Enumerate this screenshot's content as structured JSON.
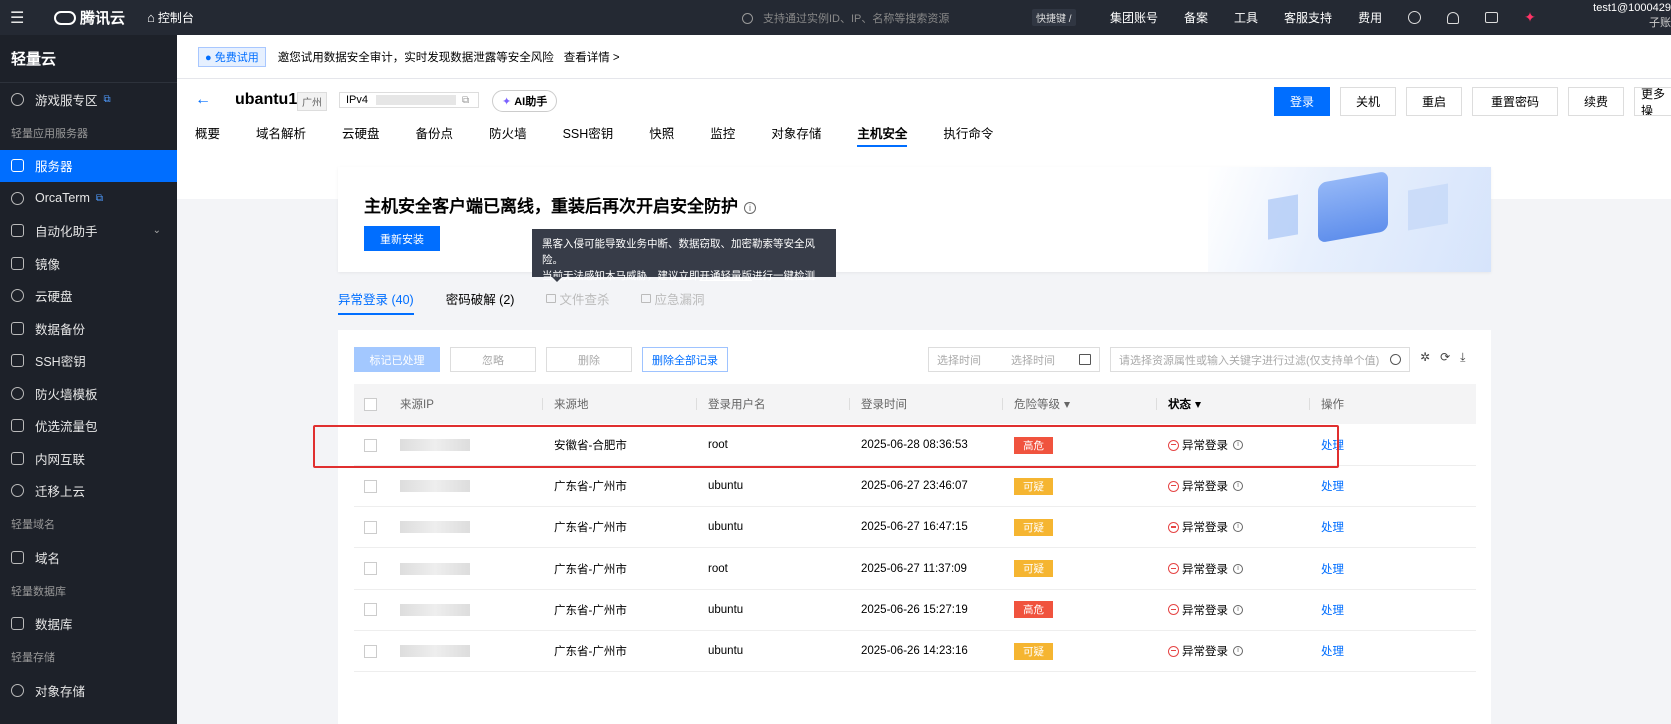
{
  "topbar": {
    "brand": "腾讯云",
    "console": "控制台",
    "search_placeholder": "支持通过实例ID、IP、名称等搜索资源",
    "shortcut": "快捷键 /",
    "nav": [
      "集团账号",
      "备案",
      "工具",
      "客服支持",
      "费用"
    ],
    "user_line1": "test1@1000429",
    "user_line2": "子账"
  },
  "sidebar": {
    "title": "轻量云",
    "items": [
      {
        "label": "游戏服专区",
        "type": "item",
        "icon": "gamepad-icon",
        "ext": true
      },
      {
        "label": "轻量应用服务器",
        "type": "group"
      },
      {
        "label": "服务器",
        "type": "item",
        "icon": "cube-icon",
        "active": true
      },
      {
        "label": "OrcaTerm",
        "type": "item",
        "icon": "terminal-icon",
        "ext": true
      },
      {
        "label": "自动化助手",
        "type": "item",
        "icon": "robot-icon",
        "chev": true
      },
      {
        "label": "镜像",
        "type": "item",
        "icon": "disc-icon"
      },
      {
        "label": "云硬盘",
        "type": "item",
        "icon": "disk-icon"
      },
      {
        "label": "数据备份",
        "type": "item",
        "icon": "backup-icon"
      },
      {
        "label": "SSH密钥",
        "type": "item",
        "icon": "key-icon"
      },
      {
        "label": "防火墙模板",
        "type": "item",
        "icon": "shield-icon"
      },
      {
        "label": "优选流量包",
        "type": "item",
        "icon": "package-icon"
      },
      {
        "label": "内网互联",
        "type": "item",
        "icon": "network-icon"
      },
      {
        "label": "迁移上云",
        "type": "item",
        "icon": "migrate-icon"
      },
      {
        "label": "轻量域名",
        "type": "group"
      },
      {
        "label": "域名",
        "type": "item",
        "icon": "domain-icon"
      },
      {
        "label": "轻量数据库",
        "type": "group"
      },
      {
        "label": "数据库",
        "type": "item",
        "icon": "database-icon"
      },
      {
        "label": "轻量存储",
        "type": "group"
      },
      {
        "label": "对象存储",
        "type": "item",
        "icon": "storage-icon"
      }
    ]
  },
  "notice": {
    "badge": "免费试用",
    "text": "邀您试用数据安全审计，实时发现数据泄露等安全风险",
    "more": "查看详情 >"
  },
  "instance": {
    "name": "ubantu1",
    "region": "广州",
    "ip_label": "IPv4",
    "ai_label": "AI助手"
  },
  "actions": [
    "登录",
    "关机",
    "重启",
    "重置密码",
    "续费",
    "更多操"
  ],
  "tabs": [
    "概要",
    "域名解析",
    "云硬盘",
    "备份点",
    "防火墙",
    "SSH密钥",
    "快照",
    "监控",
    "对象存储",
    "主机安全",
    "执行命令"
  ],
  "active_tab": "主机安全",
  "banner": {
    "title": "主机安全客户端已离线，重装后再次开启安全防护",
    "button": "重新安装"
  },
  "tooltip": {
    "line1": "黑客入侵可能导致业务中断、数据窃取、加密勒索等安全风险。",
    "line2_pre": "当前无法感知木马威胁，建议立即",
    "line2_link": "开通轻量版",
    "line2_post": "进行一键检测"
  },
  "subtabs": [
    {
      "label": "异常登录 (40)",
      "state": "active"
    },
    {
      "label": "密码破解 (2)",
      "state": "normal"
    },
    {
      "label": "文件查杀",
      "state": "disabled"
    },
    {
      "label": "应急漏洞",
      "state": "disabled"
    }
  ],
  "toolbar": {
    "mark_handled": "标记已处理",
    "ignore": "忽略",
    "delete": "删除",
    "delete_all": "删除全部记录",
    "date_start": "选择时间",
    "date_end": "选择时间",
    "filter_placeholder": "请选择资源属性或输入关键字进行过滤(仅支持单个值)"
  },
  "table": {
    "headers": [
      "来源IP",
      "来源地",
      "登录用户名",
      "登录时间",
      "危险等级",
      "状态",
      "操作"
    ],
    "rows": [
      {
        "location": "安徽省-合肥市",
        "user": "root",
        "time": "2025-06-28 08:36:53",
        "risk": "高危",
        "risk_level": "high",
        "status": "异常登录",
        "op": "处理"
      },
      {
        "location": "广东省-广州市",
        "user": "ubuntu",
        "time": "2025-06-27 23:46:07",
        "risk": "可疑",
        "risk_level": "sus",
        "status": "异常登录",
        "op": "处理"
      },
      {
        "location": "广东省-广州市",
        "user": "ubuntu",
        "time": "2025-06-27 16:47:15",
        "risk": "可疑",
        "risk_level": "sus",
        "status": "异常登录",
        "op": "处理"
      },
      {
        "location": "广东省-广州市",
        "user": "root",
        "time": "2025-06-27 11:37:09",
        "risk": "可疑",
        "risk_level": "sus",
        "status": "异常登录",
        "op": "处理"
      },
      {
        "location": "广东省-广州市",
        "user": "ubuntu",
        "time": "2025-06-26 15:27:19",
        "risk": "高危",
        "risk_level": "high",
        "status": "异常登录",
        "op": "处理"
      },
      {
        "location": "广东省-广州市",
        "user": "ubuntu",
        "time": "2025-06-26 14:23:16",
        "risk": "可疑",
        "risk_level": "sus",
        "status": "异常登录",
        "op": "处理"
      }
    ]
  },
  "colors": {
    "accent": "#006eff",
    "high": "#f0533e",
    "suspicious": "#f5b531",
    "highlight_border": "#e02f2f"
  }
}
